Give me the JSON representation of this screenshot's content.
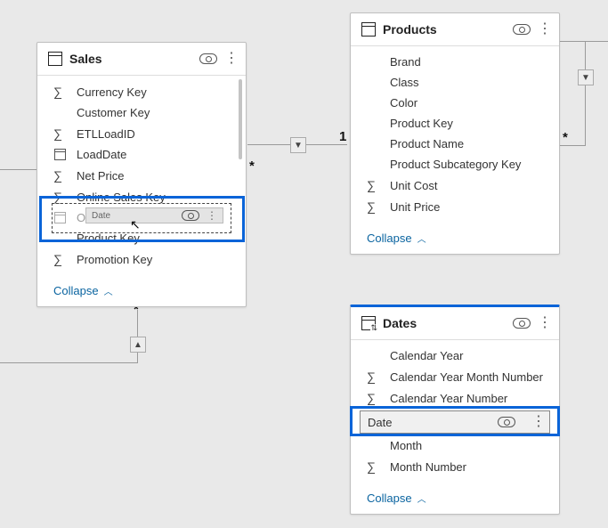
{
  "sales": {
    "title": "Sales",
    "fields": {
      "currencyKey": "Currency Key",
      "customerKey": "Customer Key",
      "etlLoadId": "ETLLoadID",
      "loadDate": "LoadDate",
      "netPrice": "Net Price",
      "onlineSalesKey": "Online Sales Key",
      "orderDate": "Order Date",
      "productKey": "Product Key",
      "promotionKey": "Promotion Key"
    },
    "collapse": "Collapse",
    "dragLabel": "Date"
  },
  "products": {
    "title": "Products",
    "fields": {
      "brand": "Brand",
      "class": "Class",
      "color": "Color",
      "productKey": "Product Key",
      "productName": "Product Name",
      "productSubcategoryKey": "Product Subcategory Key",
      "unitCost": "Unit Cost",
      "unitPrice": "Unit Price"
    },
    "collapse": "Collapse"
  },
  "dates": {
    "title": "Dates",
    "fields": {
      "calendarYear": "Calendar Year",
      "calendarYearMonthNumber": "Calendar Year Month Number",
      "calendarYearNumber": "Calendar Year Number",
      "date": "Date",
      "month": "Month",
      "monthNumber": "Month Number"
    },
    "collapse": "Collapse"
  },
  "cardinality": {
    "one": "1",
    "many": "*"
  }
}
